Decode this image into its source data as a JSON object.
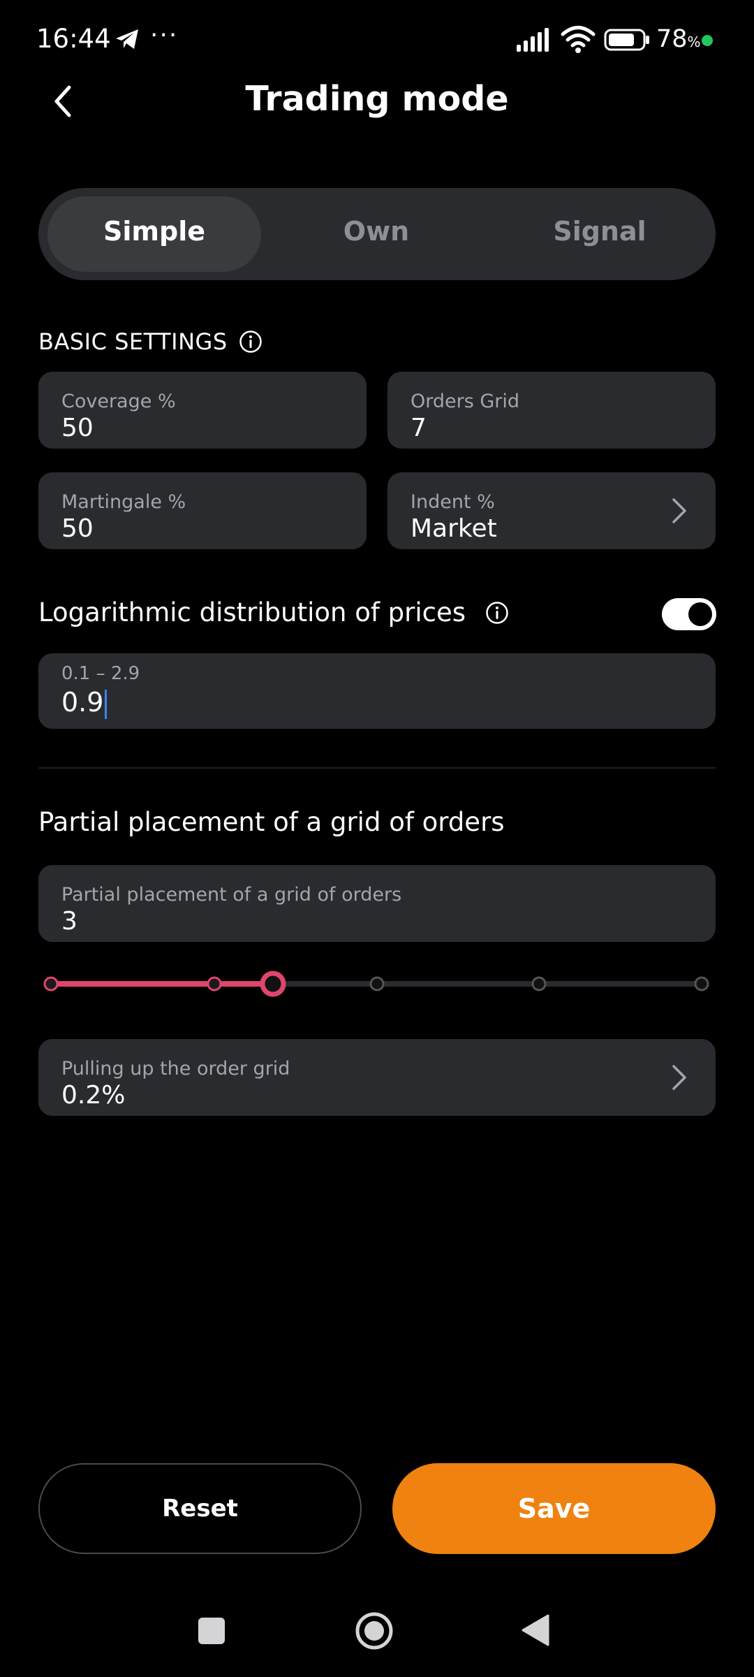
{
  "status_bar": {
    "time": "16:44",
    "dots": "···",
    "battery_percent": "78",
    "battery_unit": "%",
    "battery_level": 0.78,
    "dot_color": "#22c55e"
  },
  "header": {
    "title": "Trading mode"
  },
  "tabs": [
    {
      "label": "Simple",
      "active": true
    },
    {
      "label": "Own",
      "active": false
    },
    {
      "label": "Signal",
      "active": false
    }
  ],
  "basic_settings": {
    "title": "BASIC SETTINGS",
    "coverage": {
      "label": "Coverage %",
      "value": "50"
    },
    "orders_grid": {
      "label": "Orders Grid",
      "value": "7"
    },
    "martingale": {
      "label": "Martingale %",
      "value": "50"
    },
    "indent": {
      "label": "Indent %",
      "value": "Market"
    }
  },
  "log_distribution": {
    "title": "Logarithmic distribution of prices",
    "enabled": true,
    "range_label": "0.1 – 2.9",
    "value": "0.9"
  },
  "partial_placement": {
    "title": "Partial placement of a grid of orders",
    "field_label": "Partial placement of a grid of orders",
    "value": "3",
    "slider": {
      "current": 3,
      "max": 7,
      "accent": "#e0456e"
    }
  },
  "pulling_up": {
    "label": "Pulling up the order grid",
    "value": "0.2%"
  },
  "buttons": {
    "reset": "Reset",
    "save": "Save"
  },
  "colors": {
    "accent": "#ef8210",
    "card": "#2a2b2e",
    "slider_accent": "#e0456e"
  }
}
